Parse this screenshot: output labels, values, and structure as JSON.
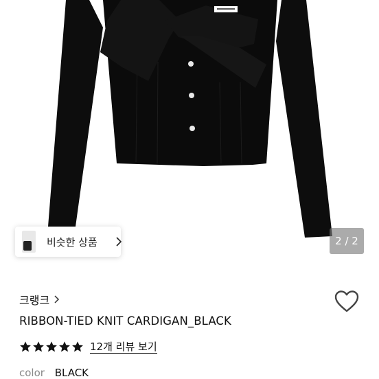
{
  "gallery": {
    "image_alt": "RIBBON-TIED KNIT CARDIGAN_BLACK",
    "counter": "2 / 2",
    "garment_label": "PRODUCT LABEL"
  },
  "similar": {
    "label": "비슷한 상품"
  },
  "brand": {
    "name": "크랭크"
  },
  "product": {
    "title": "RIBBON-TIED KNIT CARDIGAN_BLACK"
  },
  "rating": {
    "stars": 5,
    "review_link": "12개 리뷰 보기"
  },
  "option": {
    "key": "color",
    "value": "BLACK"
  },
  "colors": {
    "garment": "#0d0d0d",
    "ribbon": "#141414",
    "button": "#e8e8e8",
    "text": "#111111",
    "muted": "#888888",
    "counter_bg": "#7a7a7a"
  }
}
